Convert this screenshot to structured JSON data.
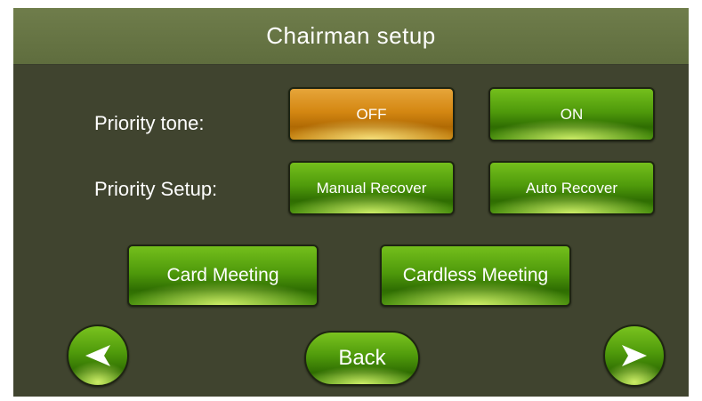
{
  "header": {
    "title": "Chairman setup"
  },
  "priority_tone": {
    "label": "Priority tone:",
    "off_label": "OFF",
    "on_label": "ON",
    "selected": "OFF",
    "selected_color": "#d48712",
    "unselected_color": "#4f9a0b"
  },
  "priority_setup": {
    "label": "Priority Setup:",
    "manual_label": "Manual Recover",
    "auto_label": "Auto Recover"
  },
  "meeting": {
    "card_label": "Card Meeting",
    "cardless_label": "Cardless Meeting"
  },
  "footer": {
    "back_label": "Back",
    "prev_icon": "left-arrow-icon",
    "next_icon": "right-arrow-icon"
  },
  "colors": {
    "background": "#40442f",
    "title_bar": "#66744a",
    "button_green": "#4f9a0b",
    "button_orange": "#d48712"
  }
}
